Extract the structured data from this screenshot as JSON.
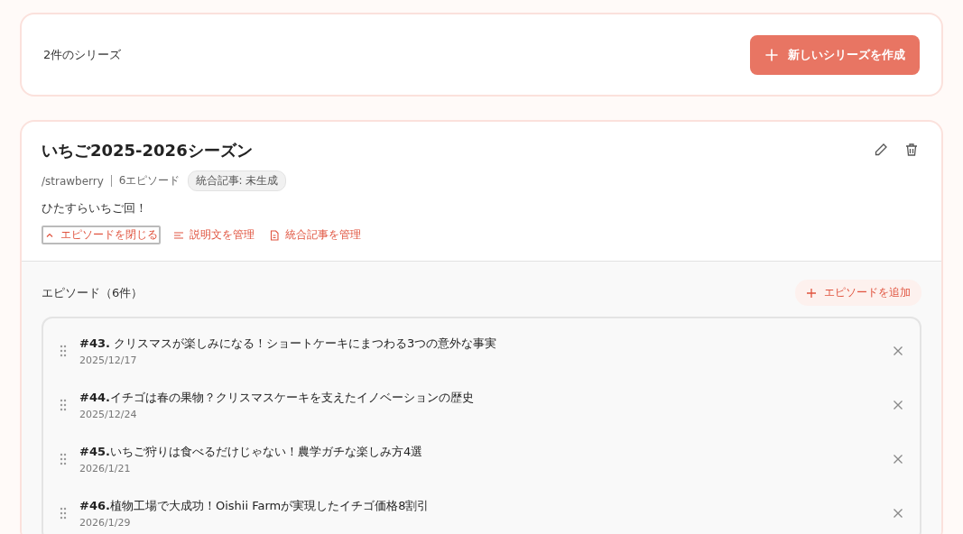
{
  "header": {
    "count_label": "2件のシリーズ",
    "create_button": "新しいシリーズを作成"
  },
  "series": {
    "title": "いちご2025-2026シーズン",
    "slug": "/strawberry",
    "episode_count": "6エピソード",
    "status_badge": "統合記事: 未生成",
    "description": "ひたすらいちご回！",
    "expanded": true,
    "actions": [
      {
        "kind": "toggle",
        "label": "エピソードを閉じる"
      },
      {
        "kind": "description",
        "label": "説明文を管理"
      },
      {
        "kind": "article",
        "label": "統合記事を管理"
      }
    ],
    "episodes_heading": "エピソード（6件）",
    "add_episode_button": "エピソードを追加",
    "episodes": [
      {
        "title": "**#43.** クリスマスが楽しみになる！ショートケーキにまつわる3つの意外な事実",
        "date": "2025/12/17"
      },
      {
        "title": "**#44.**イチゴは春の果物？クリスマスケーキを支えたイノベーションの歴史",
        "date": "2025/12/24"
      },
      {
        "title": "**#45.**いちご狩りは食べるだけじゃない！農学ガチな楽しみ方4選",
        "date": "2026/1/21"
      },
      {
        "title": "**#46.**植物工場で大成功！Oishii Farmが実現したイチゴ価格8割引",
        "date": "2026/1/29"
      }
    ]
  }
}
